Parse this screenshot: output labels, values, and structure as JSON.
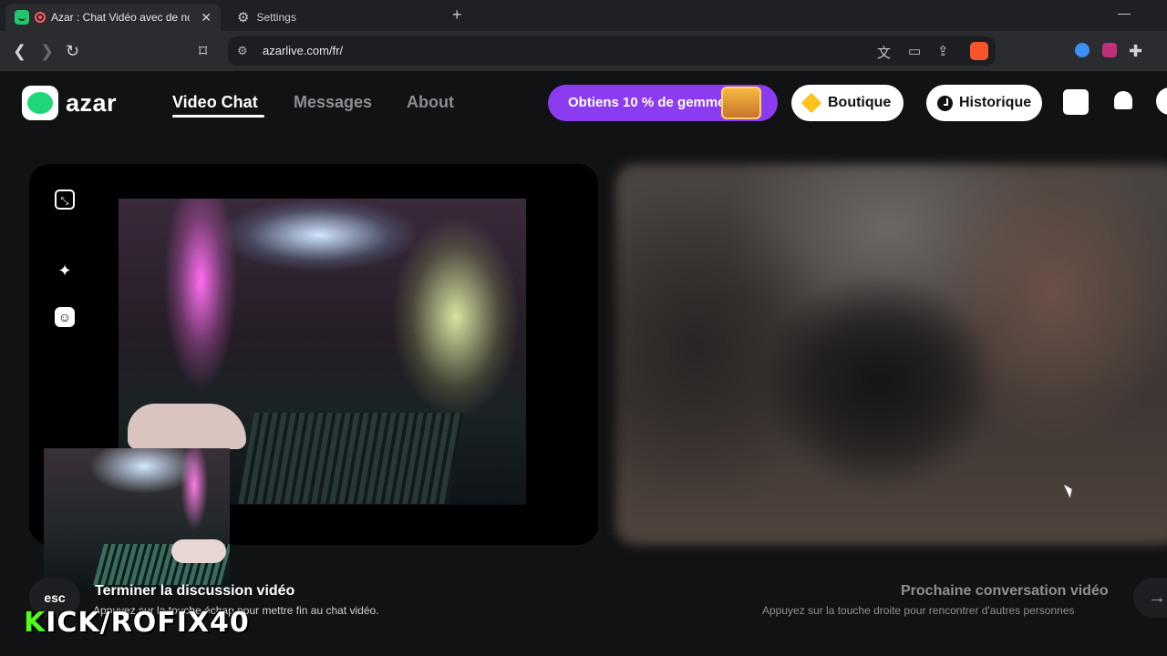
{
  "browser": {
    "tabs": [
      {
        "title": "Azar : Chat Vidéo avec de nou",
        "close": "✕"
      },
      {
        "title": "Settings"
      }
    ],
    "new_tab": "+",
    "minimize": "—",
    "url": "azarlive.com/fr/"
  },
  "site": {
    "logo_text": "azar",
    "nav": [
      {
        "label": "Video Chat"
      },
      {
        "label": "Messages"
      },
      {
        "label": "About"
      }
    ],
    "promo_text": "Obtiens 10 % de gemmes",
    "boutique_label": "Boutique",
    "history_label": "Historique"
  },
  "controls": {
    "esc_label": "esc",
    "end_title": "Terminer la discussion vidéo",
    "end_subtitle": "Appuyez sur la touche échap pour mettre fin au chat vidéo.",
    "next_title": "Prochaine conversation vidéo",
    "next_subtitle": "Appuyez sur la touche droite pour rencontrer d'autres personnes",
    "next_arrow": "→"
  },
  "watermark": {
    "k": "K",
    "rest": "ICK/ROFIX40"
  },
  "icons": {
    "collapse": "⤡",
    "magic": "✦",
    "smile": "☺"
  },
  "colors": {
    "brand_green": "#22c76b",
    "promo_purple": "#8c3cf0",
    "kick_green": "#53fc18"
  }
}
